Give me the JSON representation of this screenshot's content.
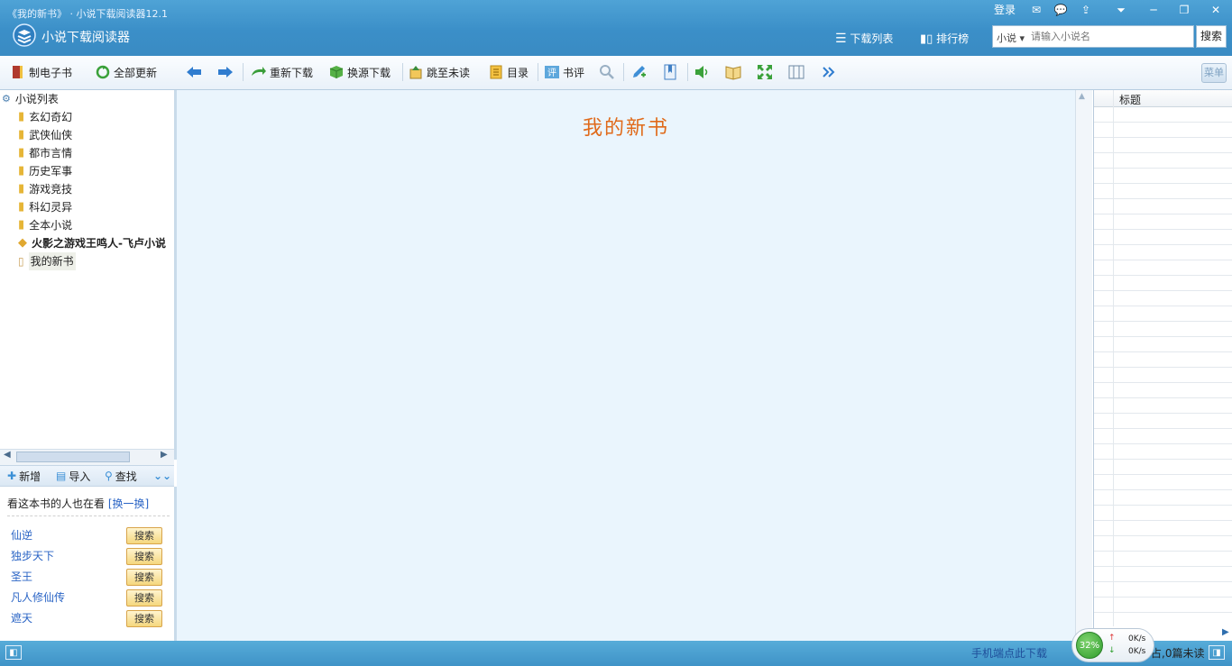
{
  "window": {
    "title": "《我的新书》 · 小说下载阅读器12.1",
    "app_name": "小说下载阅读器",
    "login": "登录"
  },
  "topnav": {
    "download_list": "下载列表",
    "ranking": "排行榜"
  },
  "search": {
    "type": "小说",
    "placeholder": "请输入小说名",
    "button": "搜索"
  },
  "toolbar": {
    "make_ebook": "制电子书",
    "update_all": "全部更新",
    "redownload": "重新下载",
    "switch_source": "换源下载",
    "jump_unread": "跳至未读",
    "toc": "目录",
    "review": "书评",
    "menu": "菜单"
  },
  "tree": {
    "root": "小说列表",
    "categories": [
      "玄幻奇幻",
      "武侠仙侠",
      "都市言情",
      "历史军事",
      "游戏竞技",
      "科幻灵异",
      "全本小说"
    ],
    "book_bold": "火影之游戏王鸣人-飞卢小说",
    "book_selected": "我的新书"
  },
  "left_tools": {
    "add": "新增",
    "import": "导入",
    "find": "查找"
  },
  "recommend": {
    "heading": "看这本书的人也在看",
    "swap": "[换一换]",
    "button": "搜索",
    "items": [
      "仙逆",
      "独步天下",
      "圣王",
      "凡人修仙传",
      "遮天"
    ]
  },
  "reader": {
    "book_title": "我的新书"
  },
  "right_panel": {
    "column_title": "标题"
  },
  "status": {
    "mobile_link": "手机端点此下载",
    "percent": "32%",
    "up_speed": "0K/s",
    "down_speed": "0K/s",
    "unread": "占,0篇未读"
  },
  "colors": {
    "titlebar": "#3b8fc8",
    "reader_bg": "#eaf5fd",
    "book_title": "#e06a1a",
    "link": "#2a64c5"
  }
}
